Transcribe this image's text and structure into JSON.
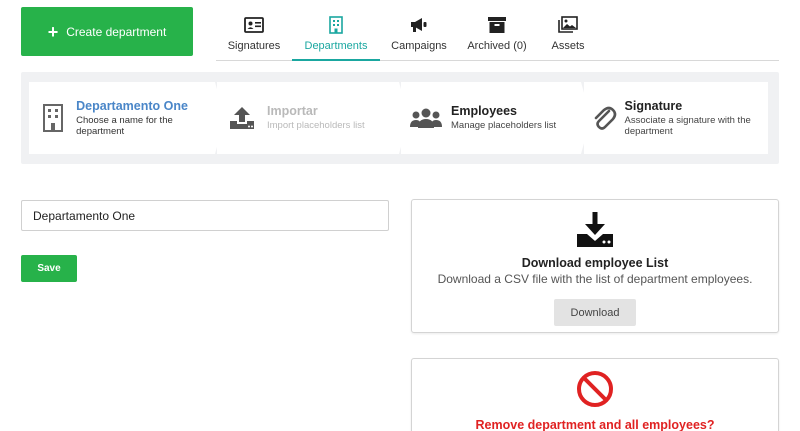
{
  "create_button": {
    "label": "Create department",
    "color": "#27b24a"
  },
  "tabs": [
    {
      "label": "Signatures",
      "icon": "id-card-icon",
      "active": false
    },
    {
      "label": "Departments",
      "icon": "building-icon",
      "active": true
    },
    {
      "label": "Campaigns",
      "icon": "megaphone-icon",
      "active": false
    },
    {
      "label": "Archived (0)",
      "icon": "archive-box-icon",
      "active": false
    },
    {
      "label": "Assets",
      "icon": "images-icon",
      "active": false
    }
  ],
  "wizard": {
    "steps": [
      {
        "title": "Departamento One",
        "desc": "Choose a name for the department",
        "icon": "building-icon",
        "state": "active"
      },
      {
        "title": "Importar",
        "desc": "Import placeholders list",
        "icon": "upload-icon",
        "state": "disabled"
      },
      {
        "title": "Employees",
        "desc": "Manage placeholders list",
        "icon": "users-icon",
        "state": "normal"
      },
      {
        "title": "Signature",
        "desc": "Associate a signature with the department",
        "icon": "paperclip-icon",
        "state": "normal"
      }
    ]
  },
  "form": {
    "name_value": "Departamento One",
    "save_label": "Save"
  },
  "download_card": {
    "title": "Download employee List",
    "desc": "Download a CSV file with the list of department employees.",
    "button_label": "Download",
    "icon": "download-icon"
  },
  "remove_card": {
    "title": "Remove department and all employees?",
    "icon": "prohibited-icon",
    "color": "#e02222"
  },
  "colors": {
    "accent": "#1aa7a0",
    "active_step": "#4a86c8",
    "primary": "#27b24a"
  }
}
